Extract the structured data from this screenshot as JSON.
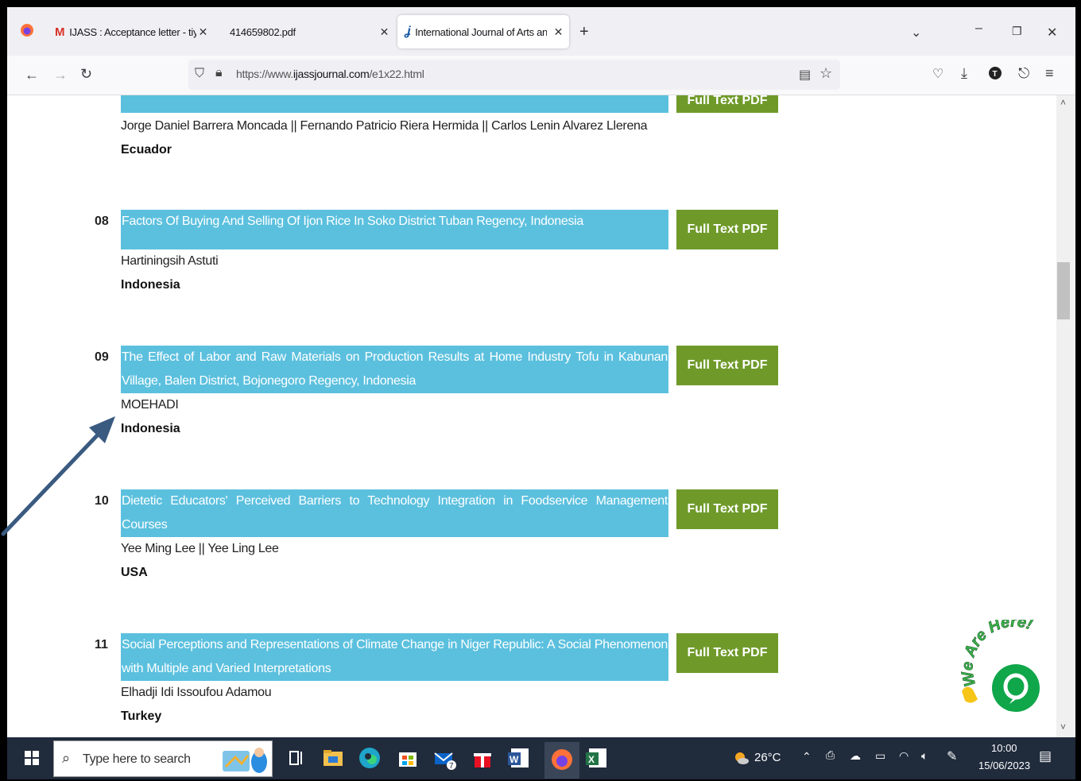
{
  "browser": {
    "tabs": [
      {
        "title": "IJASS : Acceptance letter - tiyop"
      },
      {
        "title": "414659802.pdf"
      },
      {
        "title": "International Journal of Arts anc"
      }
    ],
    "url_prefix": "https://www.",
    "url_domain": "ijassjournal.com",
    "url_suffix": "/e1x22.html"
  },
  "articles": [
    {
      "number": "",
      "title": "",
      "authors": "Jorge Daniel Barrera Moncada || Fernando Patricio Riera Hermida || Carlos Lenin Alvarez Llerena",
      "country": "Ecuador",
      "pdf_label": "Full Text PDF"
    },
    {
      "number": "08",
      "title": "Factors Of Buying And Selling Of Ijon Rice In Soko District Tuban Regency, Indonesia",
      "authors": "Hartiningsih Astuti",
      "country": "Indonesia",
      "pdf_label": "Full Text PDF"
    },
    {
      "number": "09",
      "title": "The Effect of Labor and Raw Materials on Production Results at Home Industry Tofu in Kabunan Village, Balen District, Bojonegoro Regency, Indonesia",
      "authors": "MOEHADI",
      "country": "Indonesia",
      "pdf_label": "Full Text PDF"
    },
    {
      "number": "10",
      "title": "Dietetic Educators' Perceived Barriers to Technology Integration in Foodservice Management Courses",
      "authors": "Yee Ming Lee || Yee Ling Lee",
      "country": "USA",
      "pdf_label": "Full Text PDF"
    },
    {
      "number": "11",
      "title": "Social Perceptions and Representations of Climate Change in Niger Republic: A Social Phenomenon with Multiple and Varied Interpretations",
      "authors": "Elhadji Idi Issoufou Adamou",
      "country": "Turkey",
      "pdf_label": "Full Text PDF"
    }
  ],
  "widget": {
    "text": "We Are Here!"
  },
  "taskbar": {
    "search_placeholder": "Type here to search",
    "weather": "26°C",
    "time": "10:00",
    "date": "15/06/2023",
    "mail_badge": "7"
  },
  "colors": {
    "title_bg": "#5bc0de",
    "pdf_button": "#6f9a2a",
    "arrow": "#3a5a80",
    "taskbar": "#202b3c"
  }
}
